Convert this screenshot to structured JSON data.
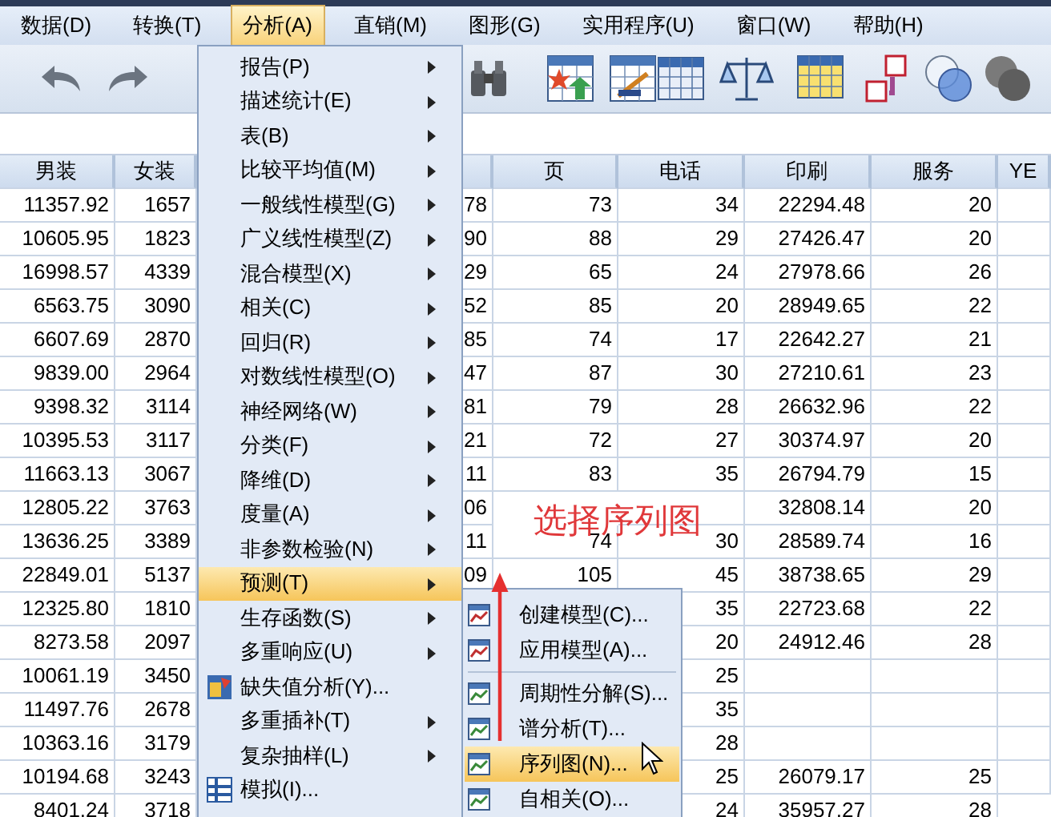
{
  "menu_bar": [
    {
      "label": "数据(D)",
      "selected": false
    },
    {
      "label": "转换(T)",
      "selected": false
    },
    {
      "label": "分析(A)",
      "selected": true
    },
    {
      "label": "直销(M)",
      "selected": false
    },
    {
      "label": "图形(G)",
      "selected": false
    },
    {
      "label": "实用程序(U)",
      "selected": false
    },
    {
      "label": "窗口(W)",
      "selected": false
    },
    {
      "label": "帮助(H)",
      "selected": false
    }
  ],
  "table": {
    "columns": [
      "男装",
      "女装",
      null,
      "页",
      "电话",
      "印刷",
      "服务",
      "YE"
    ],
    "rows": [
      [
        "11357.92",
        "1657",
        "78",
        "73",
        "34",
        "22294.48",
        "20"
      ],
      [
        "10605.95",
        "1823",
        "90",
        "88",
        "29",
        "27426.47",
        "20"
      ],
      [
        "16998.57",
        "4339",
        "29",
        "65",
        "24",
        "27978.66",
        "26"
      ],
      [
        "6563.75",
        "3090",
        "52",
        "85",
        "20",
        "28949.65",
        "22"
      ],
      [
        "6607.69",
        "2870",
        "85",
        "74",
        "17",
        "22642.27",
        "21"
      ],
      [
        "9839.00",
        "2964",
        "47",
        "87",
        "30",
        "27210.61",
        "23"
      ],
      [
        "9398.32",
        "3114",
        "81",
        "79",
        "28",
        "26632.96",
        "22"
      ],
      [
        "10395.53",
        "3117",
        "21",
        "72",
        "27",
        "30374.97",
        "20"
      ],
      [
        "11663.13",
        "3067",
        "11",
        "83",
        "35",
        "26794.79",
        "15"
      ],
      [
        "12805.22",
        "3763",
        "06",
        null,
        null,
        "32808.14",
        "20"
      ],
      [
        "13636.25",
        "3389",
        "11",
        "74",
        "30",
        "28589.74",
        "16"
      ],
      [
        "22849.01",
        "5137",
        "09",
        "105",
        "45",
        "38738.65",
        "29"
      ],
      [
        "12325.80",
        "1810",
        null,
        null,
        "35",
        "22723.68",
        "22"
      ],
      [
        "8273.58",
        "2097",
        null,
        null,
        "20",
        "24912.46",
        "28"
      ],
      [
        "10061.19",
        "3450",
        null,
        null,
        "25",
        null,
        null
      ],
      [
        "11497.76",
        "2678",
        null,
        null,
        "35",
        null,
        null
      ],
      [
        "10363.16",
        "3179",
        null,
        null,
        "28",
        null,
        null
      ],
      [
        "10194.68",
        "3243",
        null,
        null,
        "25",
        "26079.17",
        "25"
      ],
      [
        "8401.24",
        "3718",
        null,
        null,
        "24",
        "35957.27",
        "28"
      ]
    ]
  },
  "analyze_menu": {
    "items": [
      {
        "label": "报告(P)",
        "kind": "submenu",
        "selected": false
      },
      {
        "label": "描述统计(E)",
        "kind": "submenu",
        "selected": false
      },
      {
        "label": "表(B)",
        "kind": "submenu",
        "selected": false
      },
      {
        "label": "比较平均值(M)",
        "kind": "submenu",
        "selected": false
      },
      {
        "label": "一般线性模型(G)",
        "kind": "submenu",
        "selected": false
      },
      {
        "label": "广义线性模型(Z)",
        "kind": "submenu",
        "selected": false
      },
      {
        "label": "混合模型(X)",
        "kind": "submenu",
        "selected": false
      },
      {
        "label": "相关(C)",
        "kind": "submenu",
        "selected": false
      },
      {
        "label": "回归(R)",
        "kind": "submenu",
        "selected": false
      },
      {
        "label": "对数线性模型(O)",
        "kind": "submenu",
        "selected": false
      },
      {
        "label": "神经网络(W)",
        "kind": "submenu",
        "selected": false
      },
      {
        "label": "分类(F)",
        "kind": "submenu",
        "selected": false
      },
      {
        "label": "降维(D)",
        "kind": "submenu",
        "selected": false
      },
      {
        "label": "度量(A)",
        "kind": "submenu",
        "selected": false
      },
      {
        "label": "非参数检验(N)",
        "kind": "submenu",
        "selected": false
      },
      {
        "label": "预测(T)",
        "kind": "submenu",
        "selected": true
      },
      {
        "label": "生存函数(S)",
        "kind": "submenu",
        "selected": false
      },
      {
        "label": "多重响应(U)",
        "kind": "submenu",
        "selected": false
      },
      {
        "label": "缺失值分析(Y)...",
        "kind": "command",
        "selected": false
      },
      {
        "label": "多重插补(T)",
        "kind": "submenu",
        "selected": false
      },
      {
        "label": "复杂抽样(L)",
        "kind": "submenu",
        "selected": false
      },
      {
        "label": "模拟(I)...",
        "kind": "command",
        "selected": false
      }
    ]
  },
  "forecast_submenu": {
    "groups": [
      [
        {
          "label": "创建模型(C)...",
          "selected": false
        },
        {
          "label": "应用模型(A)...",
          "selected": false
        }
      ],
      [
        {
          "label": "周期性分解(S)...",
          "selected": false
        },
        {
          "label": "谱分析(T)...",
          "selected": false
        },
        {
          "label": "序列图(N)...",
          "selected": true
        },
        {
          "label": "自相关(O)...",
          "selected": false
        }
      ]
    ]
  },
  "annotation": {
    "text": "选择序列图"
  }
}
